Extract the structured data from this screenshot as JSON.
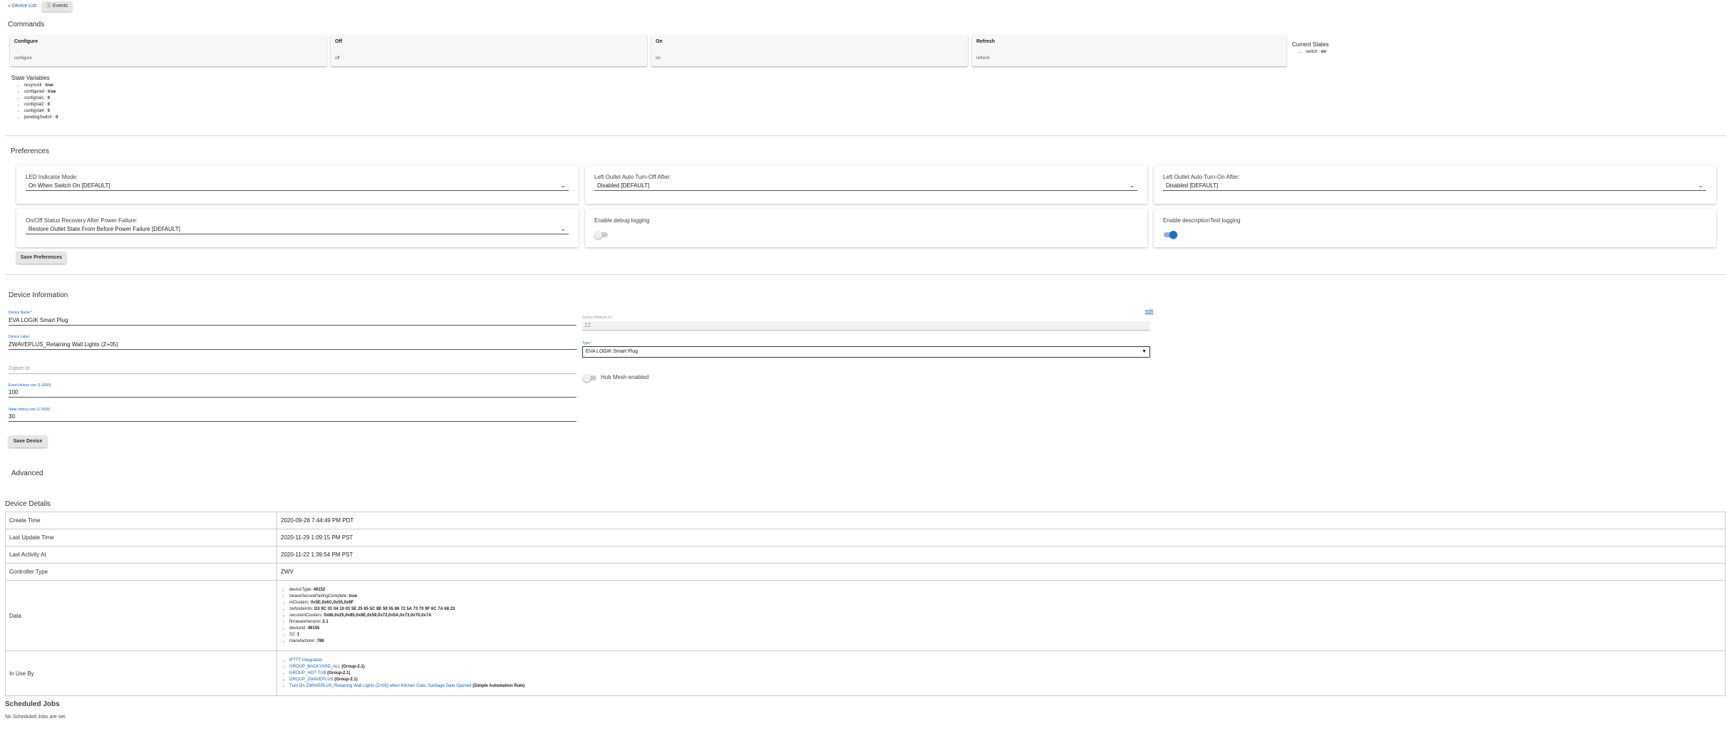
{
  "nav": {
    "device_list": "« Device List",
    "events": "Events"
  },
  "commands": {
    "heading": "Commands",
    "items": [
      {
        "title": "Configure",
        "sub": "configure"
      },
      {
        "title": "Off",
        "sub": "off"
      },
      {
        "title": "On",
        "sub": "on"
      },
      {
        "title": "Refresh",
        "sub": "refresh"
      }
    ]
  },
  "current_states": {
    "heading": "Current States",
    "items": [
      {
        "key": "switch",
        "value": "on"
      }
    ]
  },
  "state_variables": {
    "heading": "State Variables",
    "items": [
      {
        "key": "resyncAll",
        "value": "true"
      },
      {
        "key": "configured",
        "value": "true"
      },
      {
        "key": "configVal1",
        "value": "0"
      },
      {
        "key": "configVal2",
        "value": "0"
      },
      {
        "key": "configVal4",
        "value": "0"
      },
      {
        "key": "pendingSwitch",
        "value": "0"
      }
    ]
  },
  "preferences": {
    "heading": "Preferences",
    "led_label": "LED Indicator Mode:",
    "led_value": "On When Switch On [DEFAULT]",
    "auto_off_label": "Left Outlet Auto Turn-Off After:",
    "auto_off_value": "Disabled [DEFAULT]",
    "auto_on_label": "Left Outlet Auto Turn-On After:",
    "auto_on_value": "Disabled [DEFAULT]",
    "recovery_label": "On/Off Status Recovery After Power Failure:",
    "recovery_value": "Restore Outlet State From Before Power Failure [DEFAULT]",
    "debug_label": "Enable debug logging",
    "desc_label": "Enable descriptionText logging",
    "save": "Save Preferences"
  },
  "device_info": {
    "heading": "Device Information",
    "edit": "edit",
    "name_label": "Device Name *",
    "name_value": "EVA LOGIK Smart Plug",
    "network_label": "Device Network Id *",
    "network_value": "22",
    "label_label": "Device Label",
    "label_value": "ZWAVEPLUS_Retaining Wall Lights (Z+05)",
    "type_label": "Type *",
    "type_value": "EVA LOGIK Smart Plug",
    "zigbee_label": "Zigbee Id",
    "event_label": "Event history size (1-2000)",
    "event_value": "100",
    "state_label": "State history size (1-2000)",
    "state_value": "30",
    "hub_mesh": "Hub Mesh enabled",
    "save": "Save Device"
  },
  "advanced": {
    "heading": "Advanced"
  },
  "details": {
    "heading": "Device Details",
    "create_label": "Create Time",
    "create_value": "2020-09-28 7:44:49 PM PDT",
    "update_label": "Last Update Time",
    "update_value": "2020-11-29 1:09:15 PM PST",
    "activity_label": "Last Activity At",
    "activity_value": "2020-11-22 1:39:54 PM PST",
    "controller_label": "Controller Type",
    "controller_value": "ZWV",
    "data_label": "Data",
    "data_items": [
      {
        "key": "deviceType",
        "value": "49152"
      },
      {
        "key": "zwaveSecurePairingComplete",
        "value": "true"
      },
      {
        "key": "inClusters",
        "value": "0x5E,0x6C,0x55,0x9F"
      },
      {
        "key": "zwNodeInfo",
        "value": "D3 9C 01 04 10 01 5E 25 85 5C 8E 59 55 86 72 5A 73 70 9F 6C 7A 68 23"
      },
      {
        "key": "secureInClusters",
        "value": "0x86,0x25,0x85,0x8E,0x59,0x72,0x5A,0x73,0x70,0x7A"
      },
      {
        "key": "firmwareVersion",
        "value": "2.1"
      },
      {
        "key": "deviceId",
        "value": "49155"
      },
      {
        "key": "S2",
        "value": "1"
      },
      {
        "key": "manufacturer",
        "value": "786"
      }
    ],
    "inuse_label": "In Use By",
    "inuse_items": [
      {
        "link": "IFTTT Integration",
        "suffix": ""
      },
      {
        "link": "GROUP_BACKYARD_ALL",
        "suffix": "(Group-2.1)"
      },
      {
        "link": "GROUP_HOT TUB",
        "suffix": "(Group-2.1)"
      },
      {
        "link": "GROUP_ZWAVEPLUS",
        "suffix": "(Group-2.1)"
      },
      {
        "link": "Turn On ZWAVEPLUS_Retaining Wall Lights (Z+05) when Kitchen Gate, Garbage Gate Opened",
        "suffix": "(Simple Automation Rule)"
      }
    ]
  },
  "scheduled": {
    "heading": "Scheduled Jobs",
    "empty": "No Scheduled Jobs are set."
  },
  "colors": {
    "link": "#1a5fb4",
    "toggle_on": "#1e6fbf"
  }
}
